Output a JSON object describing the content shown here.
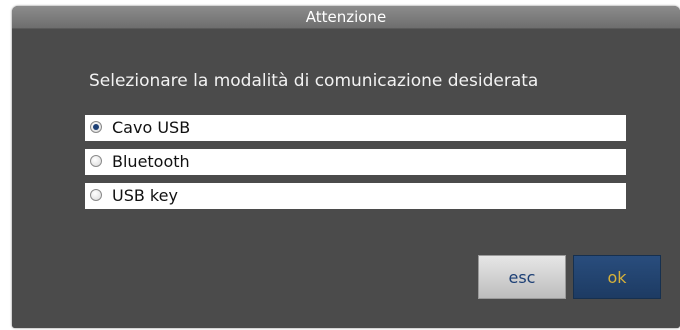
{
  "dialog": {
    "title": "Attenzione",
    "prompt": "Selezionare la modalità di comunicazione desiderata",
    "options": [
      {
        "label": "Cavo USB",
        "selected": true
      },
      {
        "label": "Bluetooth",
        "selected": false
      },
      {
        "label": "USB key",
        "selected": false
      }
    ],
    "buttons": {
      "esc_label": "esc",
      "ok_label": "ok"
    }
  },
  "colors": {
    "dialog_background": "#4b4b4b",
    "title_bar": "#7a7a7a",
    "ok_button": "#244673",
    "ok_text": "#d6b13a",
    "esc_button": "#d0d0d0",
    "esc_text": "#1c3f75"
  }
}
